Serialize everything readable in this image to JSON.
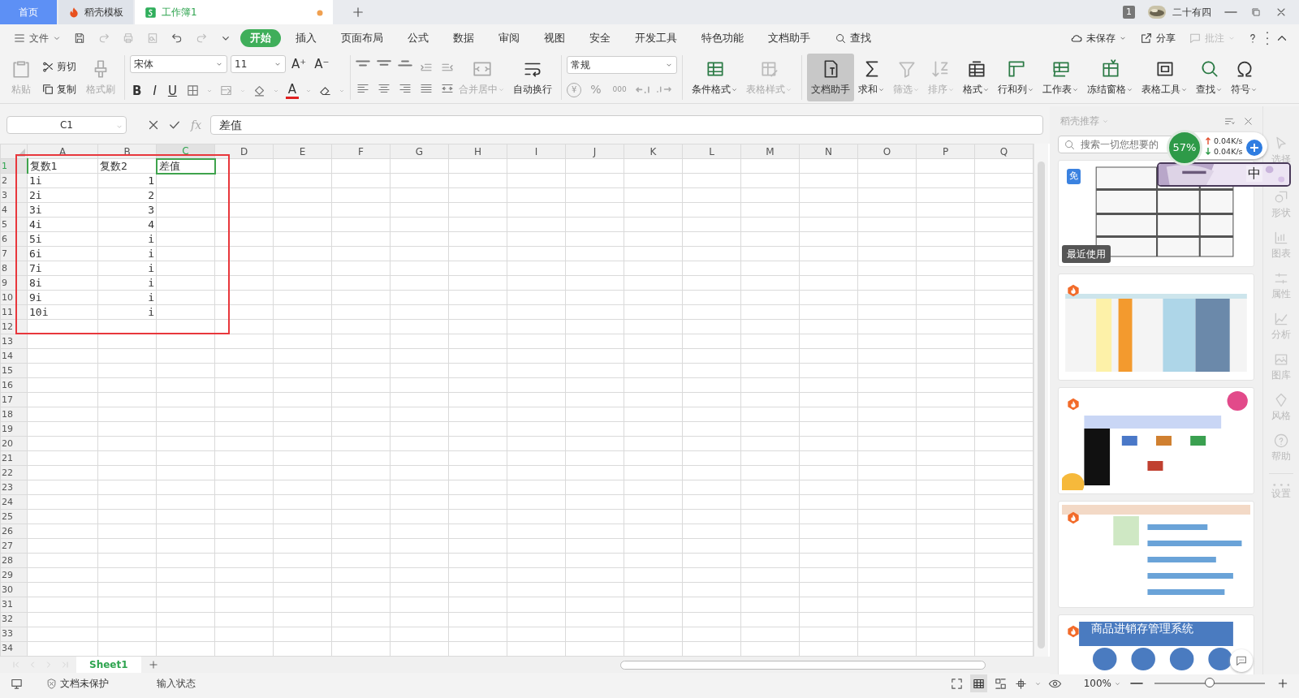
{
  "tabs": [
    {
      "label": "首页",
      "kind": "home",
      "selected": false,
      "modified": false
    },
    {
      "label": "稻壳模板",
      "kind": "docer",
      "selected": false,
      "modified": false
    },
    {
      "label": "工作簿1",
      "kind": "sheet",
      "selected": true,
      "modified": true
    }
  ],
  "titlebar": {
    "page_count": "1",
    "user": "二十有四"
  },
  "menu": {
    "file": "文件",
    "tabs": [
      {
        "label": "开始",
        "selected": true
      },
      {
        "label": "插入",
        "selected": false
      },
      {
        "label": "页面布局",
        "selected": false
      },
      {
        "label": "公式",
        "selected": false
      },
      {
        "label": "数据",
        "selected": false
      },
      {
        "label": "审阅",
        "selected": false
      },
      {
        "label": "视图",
        "selected": false
      },
      {
        "label": "安全",
        "selected": false
      },
      {
        "label": "开发工具",
        "selected": false
      },
      {
        "label": "特色功能",
        "selected": false
      },
      {
        "label": "文档助手",
        "selected": false
      },
      {
        "label": "查找",
        "selected": false
      }
    ],
    "actions": [
      {
        "label": "未保存",
        "disabled": false
      },
      {
        "label": "分享",
        "disabled": false
      },
      {
        "label": "批注",
        "disabled": true
      }
    ]
  },
  "ribbon": {
    "clipboard": [
      {
        "label": "粘贴",
        "disabled": true
      },
      {
        "label": "剪切",
        "disabled": false
      },
      {
        "label": "复制",
        "disabled": false
      },
      {
        "label": "格式刷",
        "disabled": true
      }
    ],
    "font": {
      "family": "宋体",
      "size": "11",
      "grow": "A⁺",
      "shrink": "A⁻",
      "styles": [
        "B",
        "I",
        "U"
      ],
      "color_letter": "A"
    },
    "wrap": [
      {
        "label": "合并居中",
        "disabled": true
      },
      {
        "label": "自动换行",
        "disabled": false
      }
    ],
    "number_format": "常规",
    "number_symbols": [
      "¥",
      "%",
      "000"
    ],
    "tools": [
      {
        "label": "条件格式",
        "disabled": false,
        "selected": false,
        "dropdown": true
      },
      {
        "label": "表格样式",
        "disabled": true,
        "selected": false,
        "dropdown": true
      },
      {
        "label": "文档助手",
        "disabled": false,
        "selected": true,
        "dropdown": false
      },
      {
        "label": "求和",
        "disabled": false,
        "selected": false,
        "dropdown": true
      },
      {
        "label": "筛选",
        "disabled": true,
        "selected": false,
        "dropdown": true
      },
      {
        "label": "排序",
        "disabled": true,
        "selected": false,
        "dropdown": true
      },
      {
        "label": "格式",
        "disabled": false,
        "selected": false,
        "dropdown": true
      },
      {
        "label": "行和列",
        "disabled": false,
        "selected": false,
        "dropdown": true
      },
      {
        "label": "工作表",
        "disabled": false,
        "selected": false,
        "dropdown": true
      },
      {
        "label": "冻结窗格",
        "disabled": false,
        "selected": false,
        "dropdown": true
      },
      {
        "label": "表格工具",
        "disabled": false,
        "selected": false,
        "dropdown": true
      },
      {
        "label": "查找",
        "disabled": false,
        "selected": false,
        "dropdown": true
      },
      {
        "label": "符号",
        "disabled": false,
        "selected": false,
        "dropdown": true
      }
    ]
  },
  "formula_bar": {
    "name_box": "C1",
    "fx": "fx",
    "formula": "差值"
  },
  "sheet": {
    "columns": [
      {
        "label": "A",
        "selected": false
      },
      {
        "label": "B",
        "selected": false
      },
      {
        "label": "C",
        "selected": true
      },
      {
        "label": "D",
        "selected": false
      },
      {
        "label": "E",
        "selected": false
      },
      {
        "label": "F",
        "selected": false
      },
      {
        "label": "G",
        "selected": false
      },
      {
        "label": "H",
        "selected": false
      },
      {
        "label": "I",
        "selected": false
      },
      {
        "label": "J",
        "selected": false
      },
      {
        "label": "K",
        "selected": false
      },
      {
        "label": "L",
        "selected": false
      },
      {
        "label": "M",
        "selected": false
      },
      {
        "label": "N",
        "selected": false
      },
      {
        "label": "O",
        "selected": false
      },
      {
        "label": "P",
        "selected": false
      },
      {
        "label": "Q",
        "selected": false
      }
    ],
    "rows": [
      {
        "label": "1",
        "selected": true,
        "cells": [
          {
            "text": "复数1",
            "numeric": false,
            "selected": false
          },
          {
            "text": "复数2",
            "numeric": false,
            "selected": false
          },
          {
            "text": "差值",
            "numeric": false,
            "selected": true
          }
        ]
      },
      {
        "label": "2",
        "selected": false,
        "cells": [
          {
            "text": "1i",
            "numeric": false,
            "selected": false
          },
          {
            "text": "1",
            "numeric": true,
            "selected": false
          }
        ]
      },
      {
        "label": "3",
        "selected": false,
        "cells": [
          {
            "text": "2i",
            "numeric": false,
            "selected": false
          },
          {
            "text": "2",
            "numeric": true,
            "selected": false
          }
        ]
      },
      {
        "label": "4",
        "selected": false,
        "cells": [
          {
            "text": "3i",
            "numeric": false,
            "selected": false
          },
          {
            "text": "3",
            "numeric": true,
            "selected": false
          }
        ]
      },
      {
        "label": "5",
        "selected": false,
        "cells": [
          {
            "text": "4i",
            "numeric": false,
            "selected": false
          },
          {
            "text": "4",
            "numeric": true,
            "selected": false
          }
        ]
      },
      {
        "label": "6",
        "selected": false,
        "cells": [
          {
            "text": "5i",
            "numeric": false,
            "selected": false
          },
          {
            "text": "i",
            "numeric": true,
            "selected": false
          }
        ]
      },
      {
        "label": "7",
        "selected": false,
        "cells": [
          {
            "text": "6i",
            "numeric": false,
            "selected": false
          },
          {
            "text": "i",
            "numeric": true,
            "selected": false
          }
        ]
      },
      {
        "label": "8",
        "selected": false,
        "cells": [
          {
            "text": "7i",
            "numeric": false,
            "selected": false
          },
          {
            "text": "i",
            "numeric": true,
            "selected": false
          }
        ]
      },
      {
        "label": "9",
        "selected": false,
        "cells": [
          {
            "text": "8i",
            "numeric": false,
            "selected": false
          },
          {
            "text": "i",
            "numeric": true,
            "selected": false
          }
        ]
      },
      {
        "label": "10",
        "selected": false,
        "cells": [
          {
            "text": "9i",
            "numeric": false,
            "selected": false
          },
          {
            "text": "i",
            "numeric": true,
            "selected": false
          }
        ]
      },
      {
        "label": "11",
        "selected": false,
        "cells": [
          {
            "text": "10i",
            "numeric": false,
            "selected": false
          },
          {
            "text": "i",
            "numeric": true,
            "selected": false
          }
        ]
      },
      {
        "label": "12",
        "selected": false
      },
      {
        "label": "13",
        "selected": false
      },
      {
        "label": "14",
        "selected": false
      },
      {
        "label": "15",
        "selected": false
      },
      {
        "label": "16",
        "selected": false
      },
      {
        "label": "17",
        "selected": false
      },
      {
        "label": "18",
        "selected": false
      },
      {
        "label": "19",
        "selected": false
      },
      {
        "label": "20",
        "selected": false
      },
      {
        "label": "21",
        "selected": false
      },
      {
        "label": "22",
        "selected": false
      },
      {
        "label": "23",
        "selected": false
      },
      {
        "label": "24",
        "selected": false
      },
      {
        "label": "25",
        "selected": false
      },
      {
        "label": "26",
        "selected": false
      },
      {
        "label": "27",
        "selected": false
      },
      {
        "label": "28",
        "selected": false
      },
      {
        "label": "29",
        "selected": false
      },
      {
        "label": "30",
        "selected": false
      },
      {
        "label": "31",
        "selected": false
      },
      {
        "label": "32",
        "selected": false
      },
      {
        "label": "33",
        "selected": false
      },
      {
        "label": "34",
        "selected": false
      }
    ]
  },
  "sheet_tabs": [
    {
      "label": "Sheet1",
      "selected": true
    }
  ],
  "status_bar": {
    "protection": "文档未保护",
    "input_state": "输入状态",
    "zoom": "100%",
    "zoom_slider": {
      "level": 0.5
    }
  },
  "panel": {
    "title": "稻壳推荐",
    "search_placeholder": "搜索一切您想要的",
    "templates": [
      {
        "kind": "free",
        "badge": "免",
        "label": "最近使用"
      },
      {
        "kind": "docer"
      },
      {
        "kind": "docer"
      },
      {
        "kind": "docer"
      },
      {
        "kind": "docer",
        "caption": "商品进销存管理系统"
      }
    ]
  },
  "side_rail": [
    {
      "label": "选择"
    },
    {
      "label": "形状"
    },
    {
      "label": "图表"
    },
    {
      "label": "属性"
    },
    {
      "label": "分析"
    },
    {
      "label": "图库"
    },
    {
      "label": "风格"
    },
    {
      "label": "帮助"
    },
    {
      "label": "设置"
    }
  ],
  "net_widget": {
    "percent": "57%",
    "upload": "0.04K/s",
    "download": "0.04K/s",
    "ime": "中"
  }
}
